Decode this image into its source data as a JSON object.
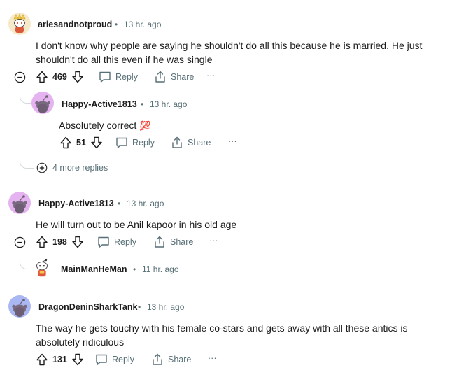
{
  "colors": {
    "text": "#1c1c1c",
    "meta": "#576f76",
    "thread_line": "#d5dadc",
    "avatar_purple": "#e4b3f0",
    "avatar_blue": "#a9b8f2"
  },
  "actions": {
    "reply_label": "Reply",
    "share_label": "Share",
    "more_label": "···"
  },
  "comments": [
    {
      "username": "ariesandnotproud",
      "time": "13 hr. ago",
      "body": "I don't know why people are saying he shouldn't do all this because he is married. He just shouldn't do all this even if he was single",
      "votes": "469",
      "avatar_icon": "snoo-costume-avatar-icon"
    },
    {
      "username": "Happy-Active1813",
      "time": "13 hr. ago",
      "body": "Absolutely correct",
      "emoji": "💯",
      "votes": "51",
      "avatar_icon": "snoo-avatar-icon"
    },
    {
      "more_replies": "4 more replies"
    },
    {
      "username": "Happy-Active1813",
      "time": "13 hr. ago",
      "body": "He will turn out to be Anil kapoor in his old age",
      "votes": "198",
      "avatar_icon": "snoo-avatar-icon"
    },
    {
      "username": "MainManHeMan",
      "time": "11 hr. ago",
      "avatar_icon": "snoo-costume-avatar-icon"
    },
    {
      "username": "DragonDeninSharkTank",
      "time": "13 hr. ago",
      "body": "The way he gets touchy with his female co-stars and gets away with all these antics is absolutely ridiculous",
      "votes": "131",
      "avatar_icon": "snoo-avatar-icon"
    }
  ]
}
